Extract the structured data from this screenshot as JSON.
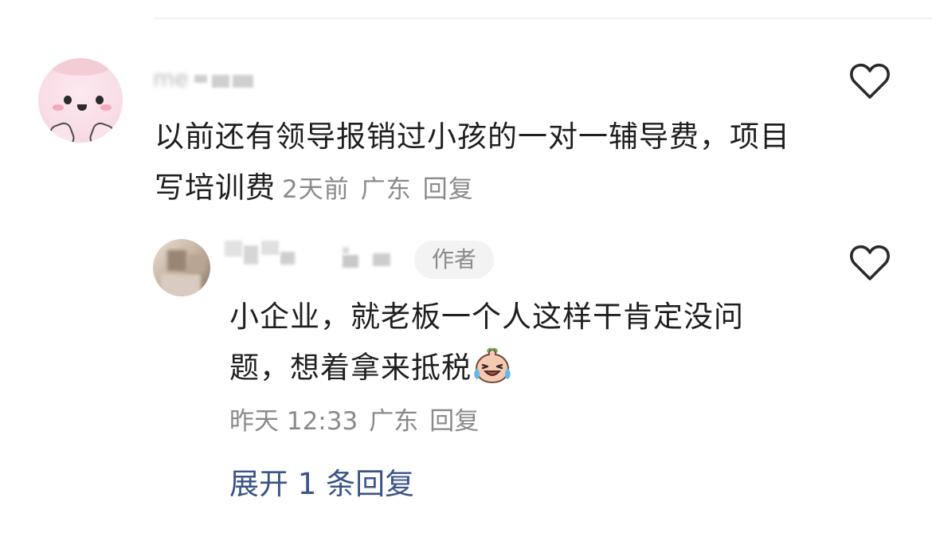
{
  "main_comment": {
    "text": "以前还有领导报销过小孩的一对一辅导费，项目写培训费",
    "time": "2天前",
    "location": "广东",
    "reply_label": "回复"
  },
  "reply_comment": {
    "author_badge": "作者",
    "text": "小企业，就老板一个人这样干肯定没问题，想着拿来抵税",
    "time": "昨天 12:33",
    "location": "广东",
    "reply_label": "回复"
  },
  "expand_label": "展开 1 条回复",
  "icons": {
    "like": "heart-outline-icon",
    "emoji": "crying-laughing-emoji-icon"
  },
  "colors": {
    "text": "#1f1f1f",
    "meta": "#8a8a8a",
    "link": "#3a5388",
    "badge_bg": "#f3f3f3",
    "divider": "#f1f1f1"
  }
}
